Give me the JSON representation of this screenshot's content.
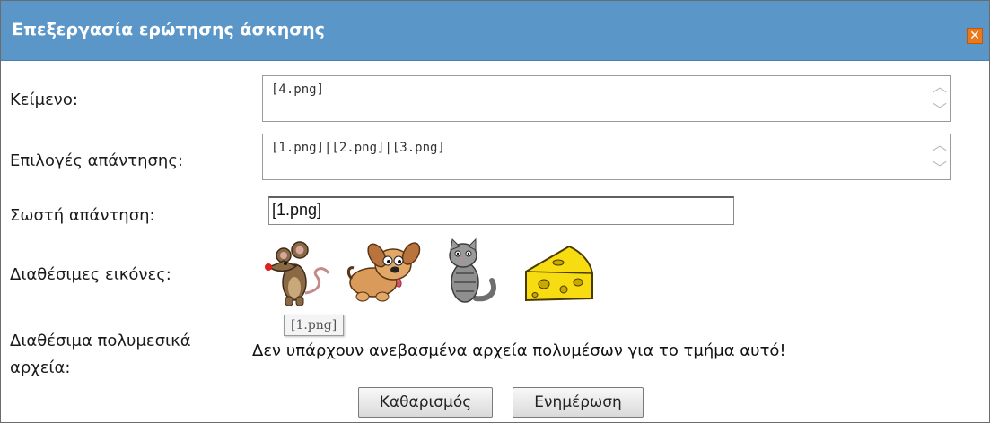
{
  "dialog": {
    "title": "Επεξεργασία ερώτησης άσκησης",
    "close_icon": "close-icon"
  },
  "form": {
    "text_label": "Κείμενο:",
    "text_value": "[4.png]",
    "choices_label": "Επιλογές απάντησης:",
    "choices_value": "[1.png]|[2.png]|[3.png]",
    "correct_label": "Σωστή απάντηση:",
    "correct_value": "[1.png]",
    "images_label": "Διαθέσιμες εικόνες:",
    "images": [
      {
        "name": "mouse-image",
        "tooltip": "[1.png]"
      },
      {
        "name": "dog-image"
      },
      {
        "name": "cat-image"
      },
      {
        "name": "cheese-image"
      }
    ],
    "tooltip": "[1.png]",
    "media_label_line1": "Διαθέσιμα πολυμεσικά",
    "media_label_line2": "αρχεία:",
    "media_message": "Δεν υπάρχουν ανεβασμένα αρχεία πολυμέσων για το τμήμα αυτό!"
  },
  "buttons": {
    "clear": "Καθαρισμός",
    "update": "Ενημέρωση"
  },
  "colors": {
    "titlebar": "#5a96c8",
    "close": "#e87a1c"
  }
}
